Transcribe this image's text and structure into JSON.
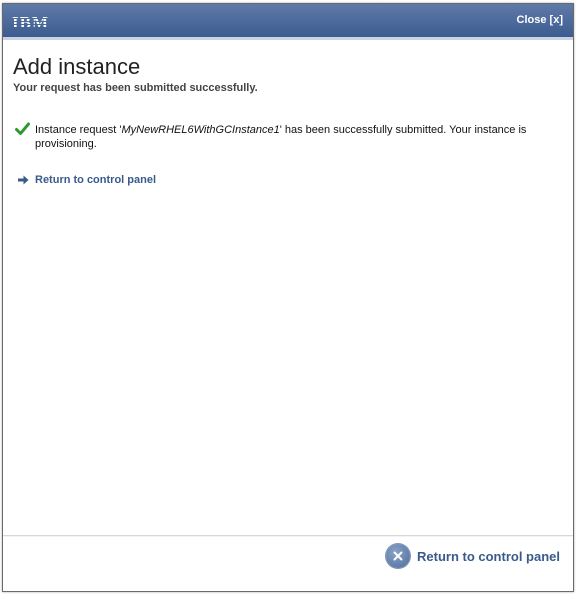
{
  "titlebar": {
    "logo_text": "IBM",
    "close_label": "Close [x]"
  },
  "header": {
    "title": "Add instance",
    "subtitle": "Your request has been submitted successfully."
  },
  "message": {
    "prefix": "Instance request '",
    "instance_name": "MyNewRHEL6WithGCInstance1",
    "suffix": "' has been successfully submitted. Your instance is provisioning."
  },
  "links": {
    "return_label": "Return to control panel"
  },
  "footer": {
    "button_label": "Return to control panel"
  },
  "colors": {
    "titlebar": "#4a6899",
    "link": "#3a5a8c",
    "success": "#2e9a2e"
  },
  "icons": {
    "success": "check-icon",
    "link": "arrow-right-icon",
    "footer": "close-circle-icon"
  }
}
